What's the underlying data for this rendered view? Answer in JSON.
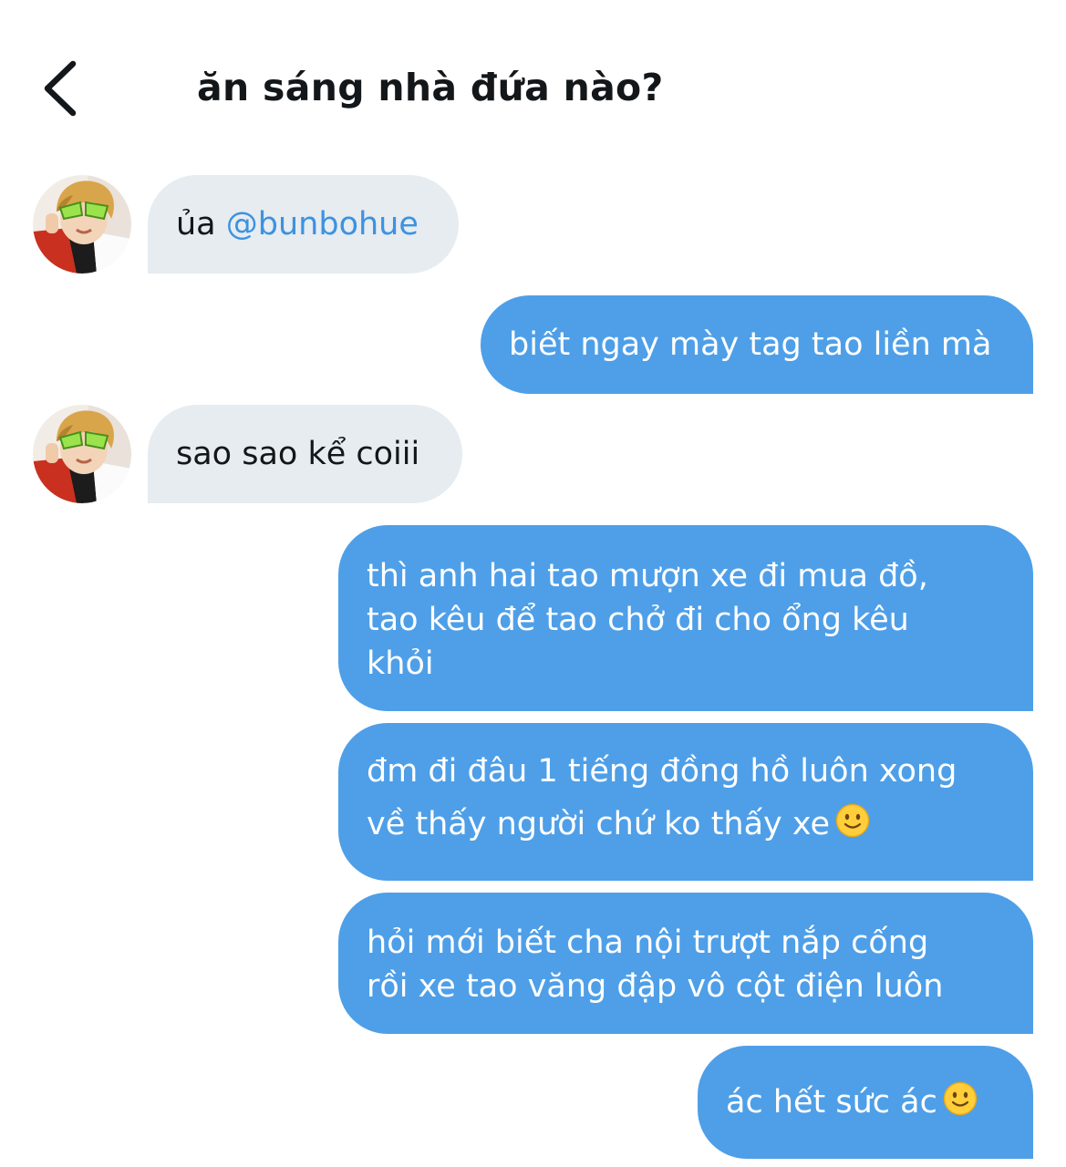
{
  "header": {
    "back_icon": "chevron-left-icon",
    "title": "ăn sáng nhà đứa nào?"
  },
  "messages": [
    {
      "sender": "other",
      "prefix": "ủa ",
      "mention": "@bunbohue"
    },
    {
      "sender": "me",
      "lines": [
        "biết ngay mày tag tao liền mà"
      ]
    },
    {
      "sender": "other",
      "text": "sao sao kể coiii"
    },
    {
      "sender": "me",
      "lines": [
        "thì anh hai tao mượn xe đi mua đồ,",
        "tao kêu để tao chở đi cho ổng kêu",
        "khỏi"
      ]
    },
    {
      "sender": "me",
      "lines": [
        "đm đi đâu 1 tiếng đồng hồ luôn xong",
        "về thấy người chứ ko thấy xe"
      ],
      "emoji": "slightly-smiling-face-icon"
    },
    {
      "sender": "me",
      "lines": [
        "hỏi mới biết cha nội trượt nắp cống",
        "rồi xe tao văng đập vô cột điện luôn"
      ]
    },
    {
      "sender": "me",
      "lines": [
        "ác hết sức ác"
      ],
      "emoji": "slightly-smiling-face-icon"
    }
  ],
  "colors": {
    "outgoing_bubble": "#4e9fe8",
    "incoming_bubble": "#e6ecf0",
    "mention": "#3d92e0",
    "text": "#14171a"
  }
}
